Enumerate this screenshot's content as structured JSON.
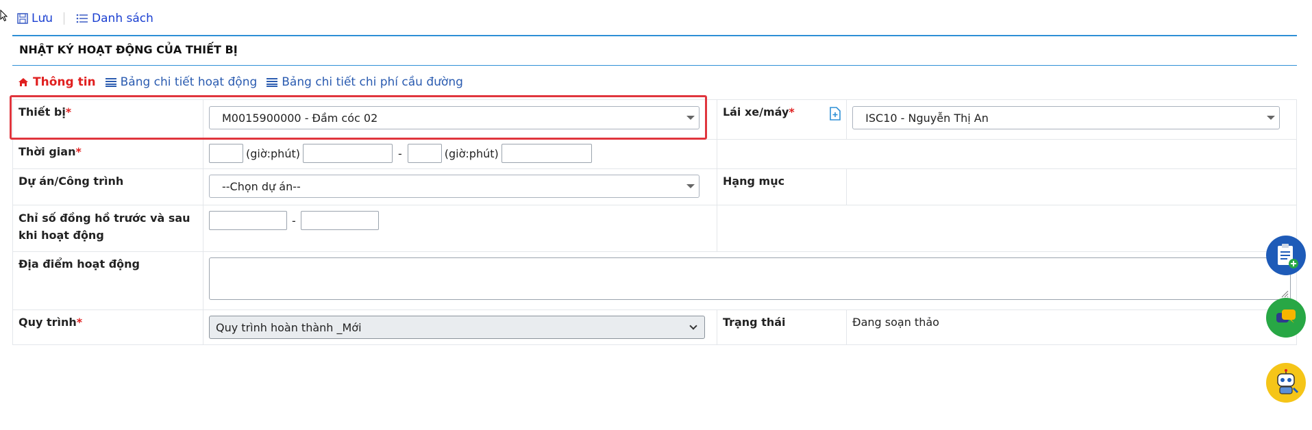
{
  "toolbar": {
    "save_label": "Lưu",
    "list_label": "Danh sách"
  },
  "panel": {
    "title": "NHẬT KÝ HOẠT ĐỘNG CỦA THIẾT BỊ"
  },
  "tabs": [
    {
      "label": "Thông tin",
      "icon": "home-icon",
      "active": true
    },
    {
      "label": "Bảng chi tiết hoạt động",
      "icon": "list-icon",
      "active": false
    },
    {
      "label": "Bảng chi tiết chi phí cầu đường",
      "icon": "list-icon",
      "active": false
    }
  ],
  "form": {
    "device": {
      "label": "Thiết bị",
      "required": "*",
      "value": "M0015900000 - Đầm cóc 02"
    },
    "driver": {
      "label": "Lái xe/máy",
      "required": "*",
      "value": "ISC10 - Nguyễn Thị An"
    },
    "time": {
      "label": "Thời gian",
      "required": "*",
      "unit": "(giờ:phút)",
      "separator": "-"
    },
    "project": {
      "label": "Dự án/Công trình",
      "value": "--Chọn dự án--"
    },
    "category": {
      "label": "Hạng mục"
    },
    "meter": {
      "label": "Chỉ số đồng hồ trước và sau khi hoạt động",
      "separator": "-"
    },
    "location": {
      "label": "Địa điểm hoạt động"
    },
    "process": {
      "label": "Quy trình",
      "required": "*",
      "value": "Quy trình hoàn thành _Mới"
    },
    "status": {
      "label": "Trạng thái",
      "value": "Đang soạn thảo"
    }
  },
  "colors": {
    "accent": "#2d8fd6",
    "required": "#e02020",
    "link": "#1a3fd1",
    "highlight": "#e0353d"
  }
}
